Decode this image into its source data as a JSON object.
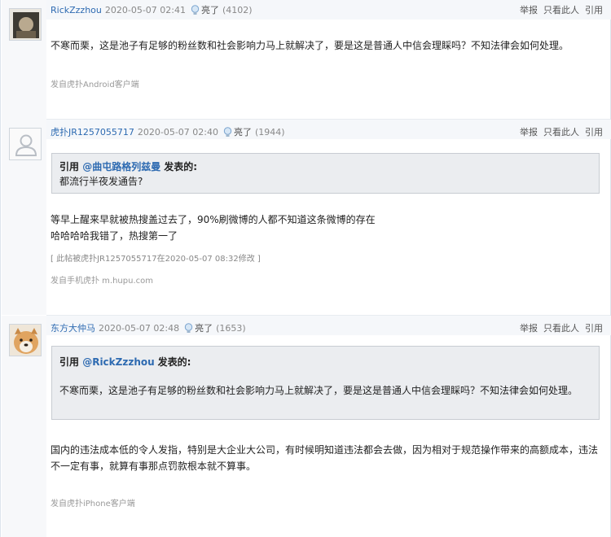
{
  "posts": [
    {
      "username": "RickZzzhou",
      "time": "2020-05-07 02:41",
      "light_label": "亮了",
      "light_count": "(4102)",
      "actions": [
        "举报",
        "只看此人",
        "引用"
      ],
      "content": "不寒而栗，这是池子有足够的粉丝数和社会影响力马上就解决了，要是这是普通人中信会理睬吗？不知法律会如何处理。",
      "device": "发自虎扑Android客户端"
    },
    {
      "username": "虎扑JR1257055717",
      "time": "2020-05-07 02:40",
      "light_label": "亮了",
      "light_count": "(1944)",
      "actions": [
        "举报",
        "只看此人",
        "引用"
      ],
      "quote": {
        "prefix": "引用",
        "at_user": "@曲屯路格列兹曼",
        "suffix": "发表的:",
        "text": "都流行半夜发通告?"
      },
      "content_lines": [
        "等早上醒来早就被热搜盖过去了，90%刷微博的人都不知道这条微博的存在",
        "哈哈哈哈我错了，热搜第一了"
      ],
      "edit_note": "[ 此帖被虎扑JR1257055717在2020-05-07 08:32修改 ]",
      "device": "发自手机虎扑 m.hupu.com"
    },
    {
      "username": "东方大仲马",
      "time": "2020-05-07 02:48",
      "light_label": "亮了",
      "light_count": "(1653)",
      "actions": [
        "举报",
        "只看此人",
        "引用"
      ],
      "quote": {
        "prefix": "引用",
        "at_user": "@RickZzzhou",
        "suffix": "发表的:",
        "text": "不寒而栗，这是池子有足够的粉丝数和社会影响力马上就解决了，要是这是普通人中信会理睬吗？不知法律会如何处理。"
      },
      "content_lines": [
        "国内的违法成本低的令人发指，特别是大企业大公司，有时候明知道违法都会去做，因为相对于规范操作带来的高额成本，违法",
        "不一定有事，就算有事那点罚款根本就不算事。"
      ],
      "device": "发自虎扑iPhone客户端"
    }
  ]
}
